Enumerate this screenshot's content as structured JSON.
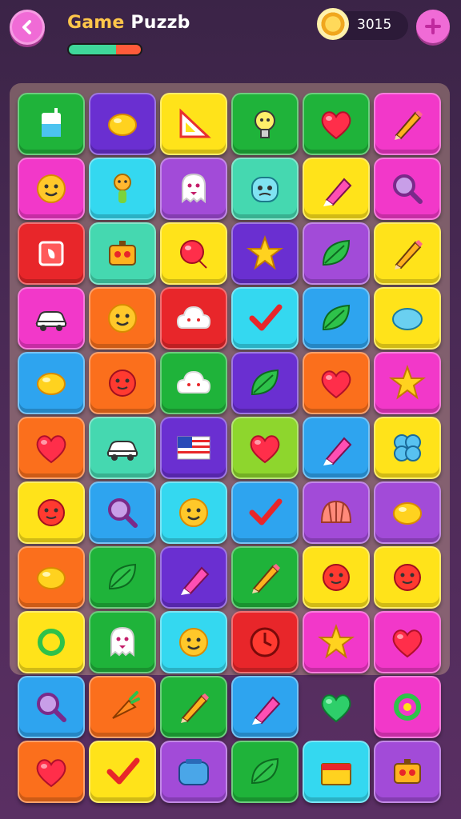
{
  "header": {
    "title_part1": "Game",
    "title_part2": " Puzzb",
    "coins": "3015",
    "progress": 0.65
  },
  "colors": {
    "green": "#1fb33a",
    "purple": "#6a2fd1",
    "yellow": "#ffe31a",
    "pink": "#f238c9",
    "cyan": "#34d8f0",
    "red": "#e8262a",
    "teal": "#45d8b0",
    "orange": "#fb6f1c",
    "blue": "#2ea4ef",
    "lime": "#8ed62d",
    "violet": "#a24bd8"
  },
  "board": {
    "rows": [
      [
        {
          "bg": "green",
          "icon": "cup-icon"
        },
        {
          "bg": "purple",
          "icon": "lemon-icon"
        },
        {
          "bg": "yellow",
          "icon": "ruler-icon"
        },
        {
          "bg": "green",
          "icon": "bulb-icon"
        },
        {
          "bg": "green",
          "icon": "heart-icon"
        },
        {
          "bg": "pink",
          "icon": "pencil-icon"
        }
      ],
      [
        {
          "bg": "pink",
          "icon": "smiley-icon"
        },
        {
          "bg": "cyan",
          "icon": "figure-icon"
        },
        {
          "bg": "violet",
          "icon": "ghost-icon"
        },
        {
          "bg": "teal",
          "icon": "monster-icon"
        },
        {
          "bg": "yellow",
          "icon": "marker-icon"
        },
        {
          "bg": "pink",
          "icon": "magnifier-icon"
        }
      ],
      [
        {
          "bg": "red",
          "icon": "shape-icon"
        },
        {
          "bg": "teal",
          "icon": "robot-icon"
        },
        {
          "bg": "yellow",
          "icon": "balloon-icon"
        },
        {
          "bg": "purple",
          "icon": "star-icon"
        },
        {
          "bg": "violet",
          "icon": "leaf-icon"
        },
        {
          "bg": "yellow",
          "icon": "pencil-icon"
        }
      ],
      [
        {
          "bg": "pink",
          "icon": "car-icon"
        },
        {
          "bg": "orange",
          "icon": "smiley-icon"
        },
        {
          "bg": "red",
          "icon": "cloud-icon"
        },
        {
          "bg": "cyan",
          "icon": "check-icon"
        },
        {
          "bg": "blue",
          "icon": "leaf-icon"
        },
        {
          "bg": "yellow",
          "icon": "bean-icon"
        }
      ],
      [
        {
          "bg": "blue",
          "icon": "lemon-icon"
        },
        {
          "bg": "orange",
          "icon": "flower-icon"
        },
        {
          "bg": "green",
          "icon": "cloud-icon"
        },
        {
          "bg": "purple",
          "icon": "leaf-icon"
        },
        {
          "bg": "orange",
          "icon": "heart-icon"
        },
        {
          "bg": "pink",
          "icon": "star-icon"
        }
      ],
      [
        {
          "bg": "orange",
          "icon": "heart-icon"
        },
        {
          "bg": "teal",
          "icon": "car-icon"
        },
        {
          "bg": "purple",
          "icon": "flag-icon"
        },
        {
          "bg": "lime",
          "icon": "heart-icon"
        },
        {
          "bg": "blue",
          "icon": "marker-icon"
        },
        {
          "bg": "yellow",
          "icon": "clover-icon"
        }
      ],
      [
        {
          "bg": "yellow",
          "icon": "flower-icon"
        },
        {
          "bg": "blue",
          "icon": "magnifier-icon"
        },
        {
          "bg": "cyan",
          "icon": "smiley-icon"
        },
        {
          "bg": "blue",
          "icon": "check-icon"
        },
        {
          "bg": "violet",
          "icon": "shell-icon"
        },
        {
          "bg": "violet",
          "icon": "lemon-icon"
        }
      ],
      [
        {
          "bg": "orange",
          "icon": "lemon-icon"
        },
        {
          "bg": "green",
          "icon": "leaf-icon"
        },
        {
          "bg": "purple",
          "icon": "marker-icon"
        },
        {
          "bg": "green",
          "icon": "pencil-icon"
        },
        {
          "bg": "yellow",
          "icon": "flower-icon"
        },
        {
          "bg": "yellow",
          "icon": "flower-icon"
        }
      ],
      [
        {
          "bg": "yellow",
          "icon": "ring-icon"
        },
        {
          "bg": "green",
          "icon": "ghost-icon"
        },
        {
          "bg": "cyan",
          "icon": "smiley-icon"
        },
        {
          "bg": "red",
          "icon": "clock-icon"
        },
        {
          "bg": "pink",
          "icon": "star-icon"
        },
        {
          "bg": "pink",
          "icon": "heart-icon"
        }
      ],
      [
        {
          "bg": "blue",
          "icon": "magnifier-icon"
        },
        {
          "bg": "orange",
          "icon": "carrot-icon"
        },
        {
          "bg": "green",
          "icon": "pencil-icon"
        },
        {
          "bg": "blue",
          "icon": "marker-icon"
        },
        {
          "bg": "none",
          "icon": "heart-icon"
        },
        {
          "bg": "pink",
          "icon": "ring-icon"
        }
      ],
      [
        {
          "bg": "orange",
          "icon": "heart-icon"
        },
        {
          "bg": "yellow",
          "icon": "check-icon"
        },
        {
          "bg": "violet",
          "icon": "toaster-icon"
        },
        {
          "bg": "green",
          "icon": "leaf-icon"
        },
        {
          "bg": "cyan",
          "icon": "box-icon"
        },
        {
          "bg": "violet",
          "icon": "robot-icon"
        }
      ]
    ]
  }
}
